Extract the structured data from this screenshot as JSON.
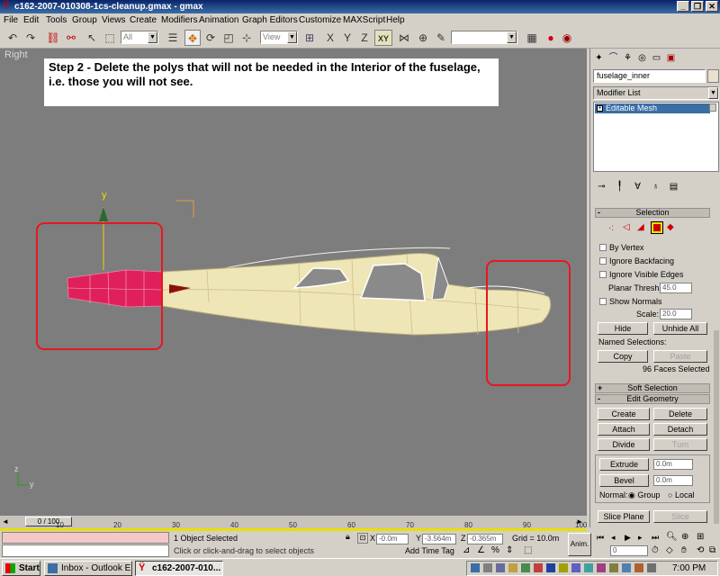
{
  "window": {
    "title": "c162-2007-010308-1cs-cleanup.gmax - gmax",
    "minimize": "_",
    "maximize": "❐",
    "close": "✕"
  },
  "menu": [
    "File",
    "Edit",
    "Tools",
    "Group",
    "Views",
    "Create",
    "Modifiers",
    "Animation",
    "Graph Editors",
    "Customize",
    "MAXScript",
    "Help"
  ],
  "toolbar": {
    "selection_filter": "All",
    "ref_coord": "View",
    "named_selection": "",
    "axis_constraint": "XY"
  },
  "viewport": {
    "label": "Right",
    "note": "Step 2 - Delete the polys that will not be needed in the Interior of the fuselage, i.e. those you will not see.",
    "axis_y": "y",
    "axis_z": "z",
    "tripod_y": "y"
  },
  "panel": {
    "object_name": "fuselage_inner",
    "modifier_list": "Modifier List",
    "stack_item": "Editable Mesh",
    "selection_rollout": {
      "title": "Selection",
      "by_vertex": "By Vertex",
      "ignore_backfacing": "Ignore Backfacing",
      "ignore_visible_edges": "Ignore Visible Edges",
      "planar_thresh_label": "Planar Thresh:",
      "planar_thresh_value": "45.0",
      "show_normals": "Show Normals",
      "scale_label": "Scale:",
      "scale_value": "20.0",
      "hide": "Hide",
      "unhide_all": "Unhide All",
      "named_selections": "Named Selections:",
      "copy": "Copy",
      "paste": "Paste",
      "faces_selected": "96 Faces Selected"
    },
    "soft_selection": "Soft Selection",
    "edit_geometry": {
      "title": "Edit Geometry",
      "create": "Create",
      "delete": "Delete",
      "attach": "Attach",
      "detach": "Detach",
      "divide": "Divide",
      "turn": "Turn",
      "extrude": "Extrude",
      "extrude_value": "0.0m",
      "bevel": "Bevel",
      "bevel_value": "0.0m",
      "normal_label": "Normal:",
      "group": "Group",
      "local": "Local",
      "slice_plane": "Slice Plane",
      "slice": "Slice"
    }
  },
  "timeline": {
    "frame": "0 / 100",
    "ticks": [
      "10",
      "20",
      "30",
      "40",
      "50",
      "60",
      "70",
      "80",
      "90",
      "100"
    ]
  },
  "status": {
    "selection": "1 Object Selected",
    "prompt": "Click or click-and-drag to select objects",
    "x_label": "X",
    "x_value": "-0.0m",
    "y_label": "Y",
    "y_value": "-3.564m",
    "z_label": "Z",
    "z_value": "-0.365m",
    "grid": "Grid = 10.0m",
    "add_time_tag": "Add Time Tag",
    "anim": "Anim.",
    "frame_field": "0"
  },
  "taskbar": {
    "start": "Start",
    "task1": "Inbox - Outlook E...",
    "task2": "c162-2007-010...",
    "clock": "7:00 PM"
  },
  "colors": {
    "viewport_bg": "#7d7d7d",
    "highlight_red": "#e8171f",
    "fuselage": "#eee6b6",
    "nose_selected": "#e0205a"
  }
}
